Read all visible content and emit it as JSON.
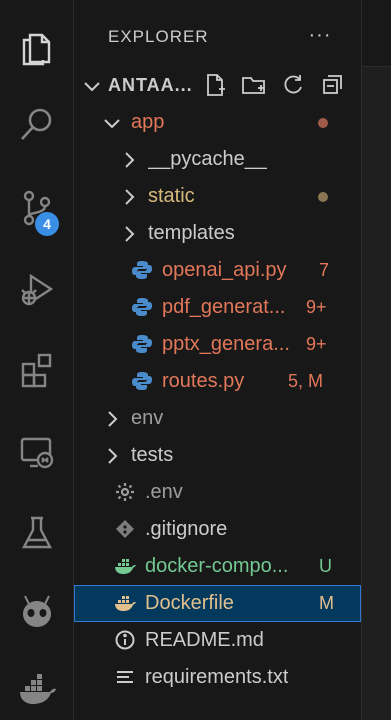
{
  "explorer": {
    "title": "EXPLORER",
    "more": "···",
    "folder": "ANTAA..."
  },
  "activity_bar": {
    "icons": [
      "files-icon",
      "search-icon",
      "source-control-icon",
      "run-debug-icon",
      "extensions-icon",
      "remote-explorer-icon",
      "testing-icon",
      "alien-icon",
      "docker-icon"
    ],
    "source_control_badge": "4"
  },
  "tree": [
    {
      "label": "app",
      "kind": "folder-open",
      "color": "#e2775a"
    },
    {
      "label": "__pycache__",
      "kind": "folder",
      "color": "#cccccc"
    },
    {
      "label": "static",
      "kind": "folder",
      "color": "#d7ba7d"
    },
    {
      "label": "templates",
      "kind": "folder",
      "color": "#cccccc"
    },
    {
      "label": "openai_api.py",
      "kind": "python",
      "status": "7",
      "color": "#e2775a"
    },
    {
      "label": "pdf_generat...",
      "kind": "python",
      "status": "9+",
      "color": "#e2775a"
    },
    {
      "label": "pptx_genera...",
      "kind": "python",
      "status": "9+",
      "color": "#e2775a"
    },
    {
      "label": "routes.py",
      "kind": "python",
      "status": "5, M",
      "color": "#e2775a"
    },
    {
      "label": "env",
      "kind": "folder",
      "color": "#9d9d9d"
    },
    {
      "label": "tests",
      "kind": "folder",
      "color": "#cccccc"
    },
    {
      "label": ".env",
      "kind": "gear",
      "color": "#9d9d9d"
    },
    {
      "label": ".gitignore",
      "kind": "git",
      "color": "#cccccc"
    },
    {
      "label": "docker-compo...",
      "kind": "docker",
      "status": "U",
      "color": "#73c991"
    },
    {
      "label": "Dockerfile",
      "kind": "docker",
      "status": "M",
      "color": "#e2c08d"
    },
    {
      "label": "README.md",
      "kind": "info",
      "color": "#cccccc"
    },
    {
      "label": "requirements.txt",
      "kind": "text",
      "color": "#cccccc"
    }
  ]
}
